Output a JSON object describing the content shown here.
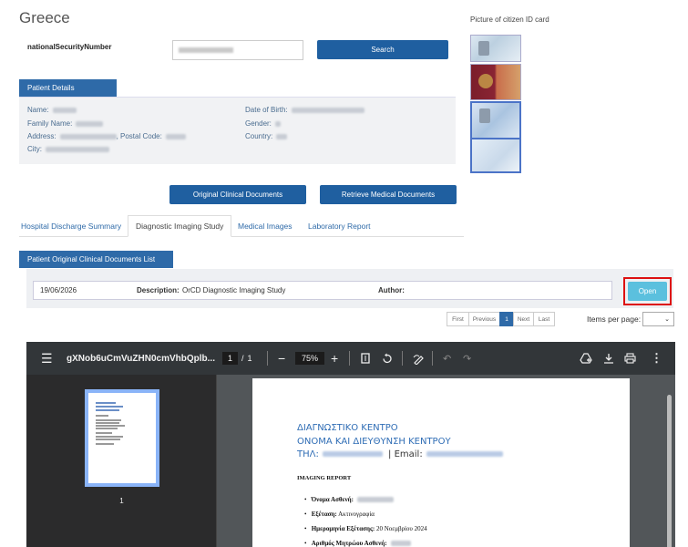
{
  "page": {
    "title": "Greece"
  },
  "search": {
    "label": "nationalSecurityNumber",
    "value": "",
    "button": "Search"
  },
  "id_pictures": {
    "label": "Picture of citizen ID card"
  },
  "patient": {
    "tab_label": "Patient Details",
    "name_label": "Name:",
    "family_label": "Family Name:",
    "address_label": "Address:",
    "postal_label": ", Postal Code:",
    "city_label": "City:",
    "dob_label": "Date of Birth:",
    "gender_label": "Gender:",
    "country_label": "Country:"
  },
  "actions": {
    "original_docs": "Original Clinical Documents",
    "retrieve_docs": "Retrieve Medical Documents"
  },
  "tabs": [
    {
      "label": "Hospital Discharge Summary"
    },
    {
      "label": "Diagnostic Imaging Study"
    },
    {
      "label": "Medical Images"
    },
    {
      "label": "Laboratory Report"
    }
  ],
  "docs_list": {
    "tab_label": "Patient Original Clinical Documents List",
    "date": "19/06/2026",
    "description_label": "Description:",
    "description_value": "OrCD Diagnostic Imaging Study",
    "author_label": "Author:",
    "open_button": "Open"
  },
  "pagination": {
    "first": "First",
    "previous": "Previous",
    "current": "1",
    "next": "Next",
    "last": "Last",
    "items_per_page_label": "Items per page:"
  },
  "pdf_viewer": {
    "filename": "gXNob6uCmVuZHN0cmVhbQplb...",
    "page_current": "1",
    "page_sep": "/",
    "page_total": "1",
    "zoom": "75%",
    "thumb_number": "1",
    "icons": [
      "menu-icon",
      "zoom-out-icon",
      "zoom-in-icon",
      "fit-page-icon",
      "rotate-icon",
      "annotate-icon",
      "undo-icon",
      "redo-icon",
      "add-drive-icon",
      "download-icon",
      "print-icon",
      "more-icon"
    ],
    "content": {
      "line1": "ΔΙΑΓΝΩΣΤΙΚΟ ΚΕΝΤΡΟ",
      "line2": "ΟΝΟΜΑ ΚΑΙ ΔΙΕΥΘΥΝΣΗ ΚΕΝΤΡΟΥ",
      "tel_label": "ΤΗΛ:",
      "email_label": "| Email:",
      "heading": "IMAGING REPORT",
      "items": [
        {
          "label": "Όνομα Ασθενή:",
          "value": ""
        },
        {
          "label": "Εξέταση:",
          "value": "Ακτινογραφία"
        },
        {
          "label": "Ημερομηνία Εξέτασης:",
          "value": "20 Νοεμβρίου 2024"
        },
        {
          "label": "Αριθμός Μητρώου Ασθενή:",
          "value": ""
        }
      ]
    }
  }
}
